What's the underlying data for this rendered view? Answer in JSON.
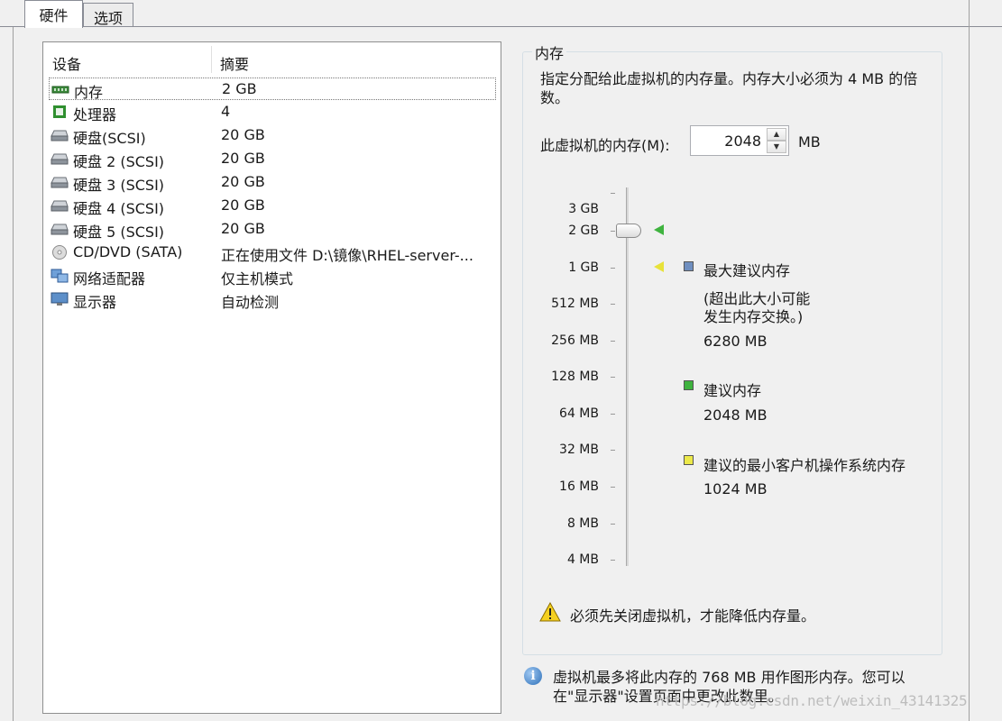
{
  "tabs": [
    {
      "label": "硬件",
      "active": true
    },
    {
      "label": "选项",
      "active": false
    }
  ],
  "device_list": {
    "headers": {
      "device": "设备",
      "summary": "摘要"
    },
    "rows": [
      {
        "icon": "memory-icon",
        "name": "内存",
        "summary": "2 GB",
        "selected": true
      },
      {
        "icon": "processor-icon",
        "name": "处理器",
        "summary": "4"
      },
      {
        "icon": "hard-disk-icon",
        "name": "硬盘(SCSI)",
        "summary": "20 GB"
      },
      {
        "icon": "hard-disk-icon",
        "name": "硬盘 2 (SCSI)",
        "summary": "20 GB"
      },
      {
        "icon": "hard-disk-icon",
        "name": "硬盘 3 (SCSI)",
        "summary": "20 GB"
      },
      {
        "icon": "hard-disk-icon",
        "name": "硬盘 4 (SCSI)",
        "summary": "20 GB"
      },
      {
        "icon": "hard-disk-icon",
        "name": "硬盘 5 (SCSI)",
        "summary": "20 GB"
      },
      {
        "icon": "cd-dvd-icon",
        "name": "CD/DVD (SATA)",
        "summary": "正在使用文件 D:\\镜像\\RHEL-server-..."
      },
      {
        "icon": "network-adapter-icon",
        "name": "网络适配器",
        "summary": "仅主机模式"
      },
      {
        "icon": "display-icon",
        "name": "显示器",
        "summary": "自动检测"
      }
    ]
  },
  "memory": {
    "group_title": "内存",
    "description": "指定分配给此虚拟机的内存量。内存大小必须为 4 MB 的倍数。",
    "field_label": "此虚拟机的内存(M):",
    "value": "2048",
    "unit": "MB",
    "slider": {
      "ticks": [
        "3 GB",
        "2 GB",
        "1 GB",
        "512 MB",
        "256 MB",
        "128 MB",
        "64 MB",
        "32 MB",
        "16 MB",
        "8 MB",
        "4 MB"
      ],
      "current": "2 GB"
    },
    "legend": {
      "max": {
        "label": "最大建议内存",
        "note_line1": "(超出此大小可能",
        "note_line2": "发生内存交换。)",
        "value": "6280 MB",
        "color": "#6f8fc0"
      },
      "recommended": {
        "label": "建议内存",
        "value": "2048 MB",
        "color": "#3fb33f"
      },
      "min_guest": {
        "label": "建议的最小客户机操作系统内存",
        "value": "1024 MB",
        "color": "#ece94a"
      }
    },
    "warning": "必须先关闭虚拟机，才能降低内存量。"
  },
  "info": {
    "line1": "虚拟机最多将此内存的 768 MB 用作图形内存。您可以",
    "line2": "在\"显示器\"设置页面中更改此数里。"
  },
  "watermark": "https://blog.csdn.net/weixin_43141325"
}
